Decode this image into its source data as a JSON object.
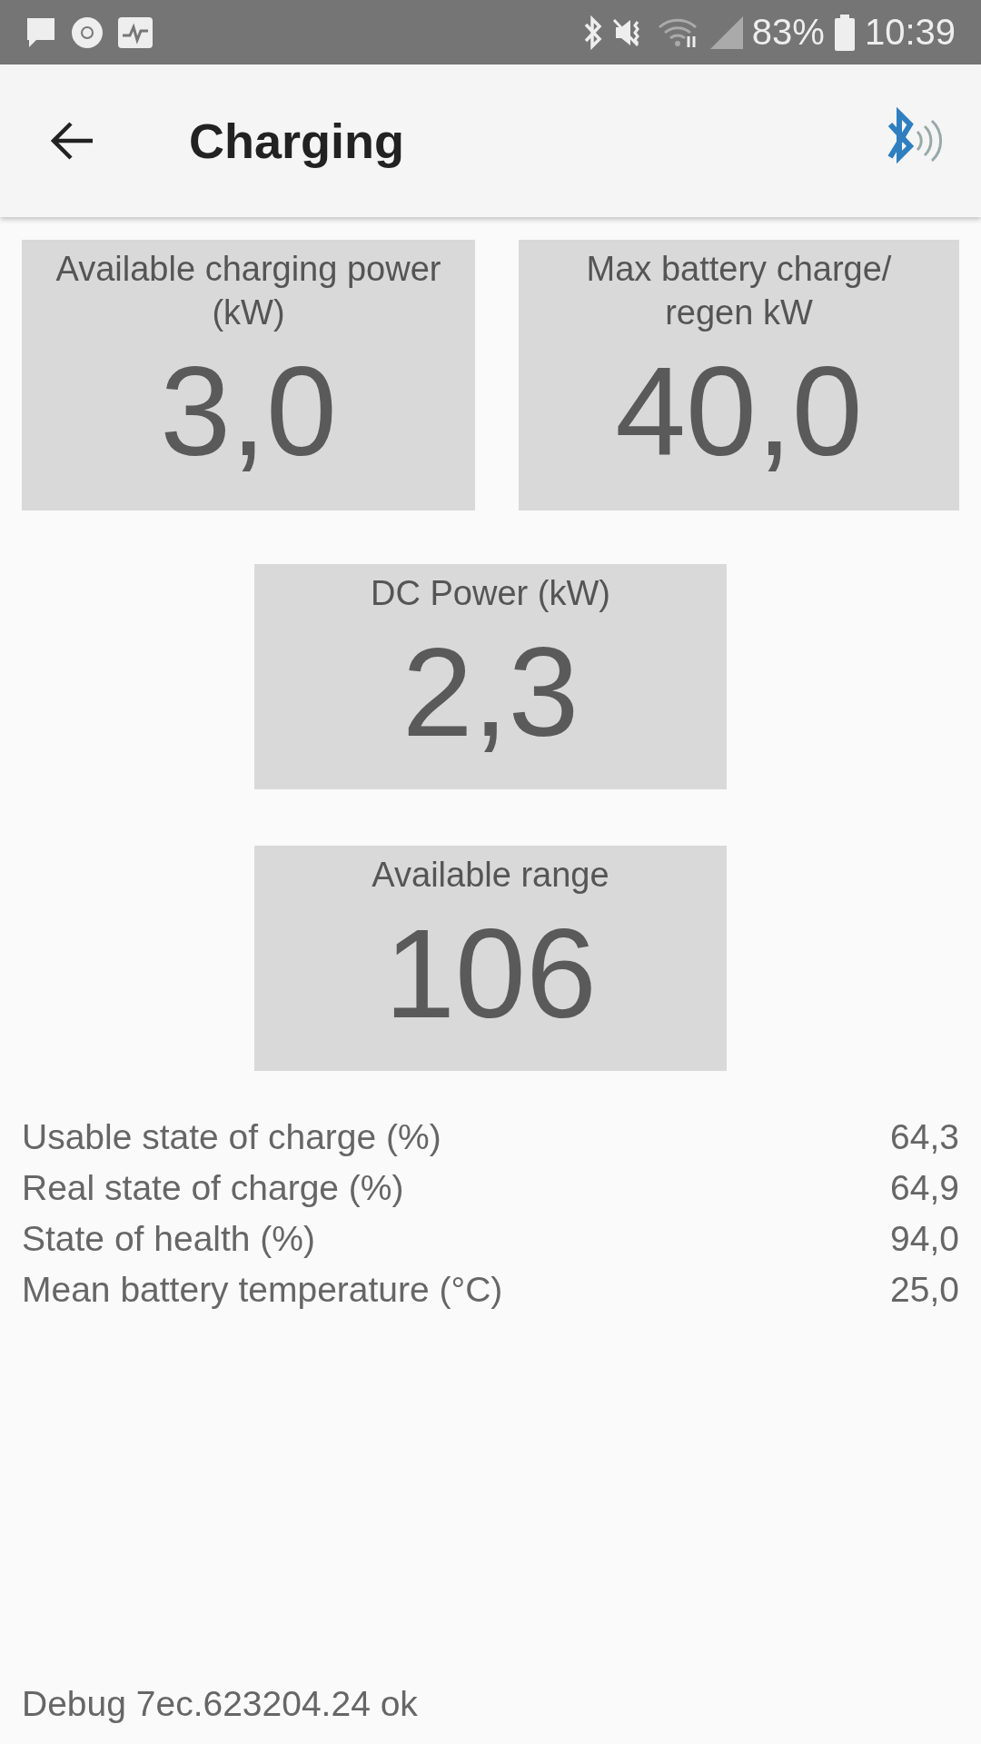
{
  "status_bar": {
    "battery": "83%",
    "time": "10:39"
  },
  "app_bar": {
    "title": "Charging"
  },
  "tiles": [
    {
      "label": "Available charging power (kW)",
      "value": "3,0"
    },
    {
      "label": "Max battery charge/ regen kW",
      "value": "40,0"
    },
    {
      "label": "DC Power (kW)",
      "value": "2,3"
    },
    {
      "label": "Available range",
      "value": "106"
    }
  ],
  "readings": [
    {
      "label": "Usable state of charge (%)",
      "value": "64,3"
    },
    {
      "label": "Real state of charge (%)",
      "value": "64,9"
    },
    {
      "label": "State of health (%)",
      "value": "94,0"
    },
    {
      "label": "Mean battery temperature (°C)",
      "value": "25,0"
    }
  ],
  "footer": "Debug 7ec.623204.24 ok"
}
